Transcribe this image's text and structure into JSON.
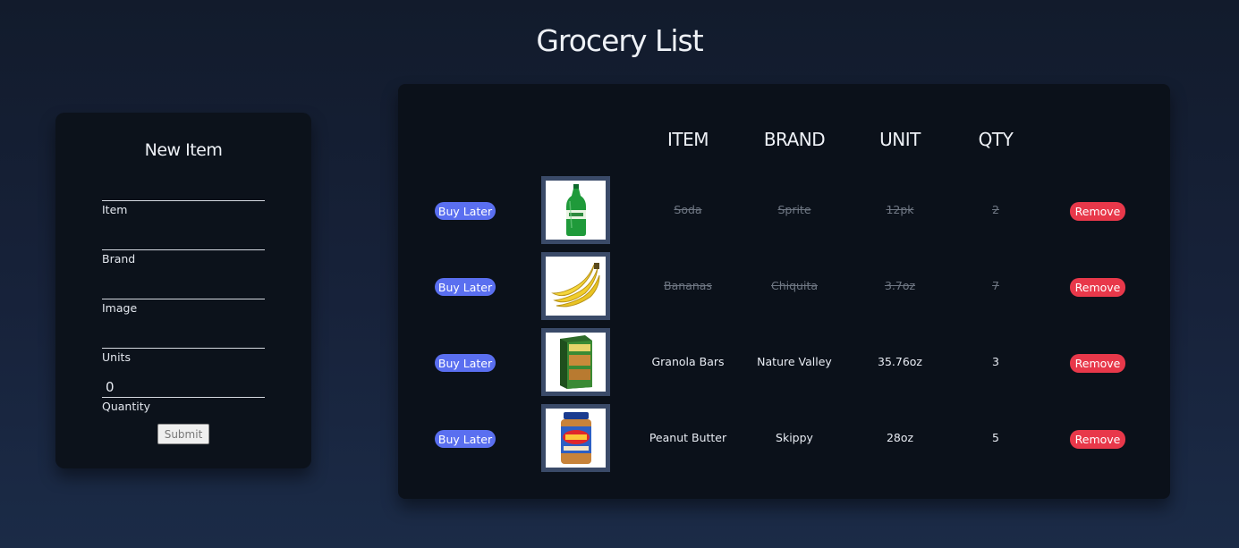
{
  "page": {
    "title": "Grocery List"
  },
  "form": {
    "title": "New Item",
    "fields": [
      {
        "label": "Item",
        "value": ""
      },
      {
        "label": "Brand",
        "value": ""
      },
      {
        "label": "Image",
        "value": ""
      },
      {
        "label": "Units",
        "value": ""
      },
      {
        "label": "Quantity",
        "value": "0"
      }
    ],
    "submit_label": "Submit"
  },
  "list": {
    "headers": {
      "item": "ITEM",
      "brand": "BRAND",
      "unit": "UNIT",
      "qty": "QTY"
    },
    "rows": [
      {
        "buy_later_label": "Buy Later",
        "image": "soda-bottle",
        "item": "Soda",
        "brand": "Sprite",
        "unit": "12pk",
        "qty": "2",
        "completed": true,
        "remove_label": "Remove"
      },
      {
        "buy_later_label": "Buy Later",
        "image": "bananas",
        "item": "Bananas",
        "brand": "Chiquita",
        "unit": "3.7oz",
        "qty": "7",
        "completed": true,
        "remove_label": "Remove"
      },
      {
        "buy_later_label": "Buy Later",
        "image": "granola-bar-box",
        "item": "Granola Bars",
        "brand": "Nature Valley",
        "unit": "35.76oz",
        "qty": "3",
        "completed": false,
        "remove_label": "Remove"
      },
      {
        "buy_later_label": "Buy Later",
        "image": "peanut-butter-jar",
        "item": "Peanut Butter",
        "brand": "Skippy",
        "unit": "28oz",
        "qty": "5",
        "completed": false,
        "remove_label": "Remove"
      }
    ]
  },
  "colors": {
    "buy_later": "#5a6ff0",
    "remove": "#e8384a",
    "card": "#0b111a",
    "thumb_border": "#3a4a68"
  }
}
